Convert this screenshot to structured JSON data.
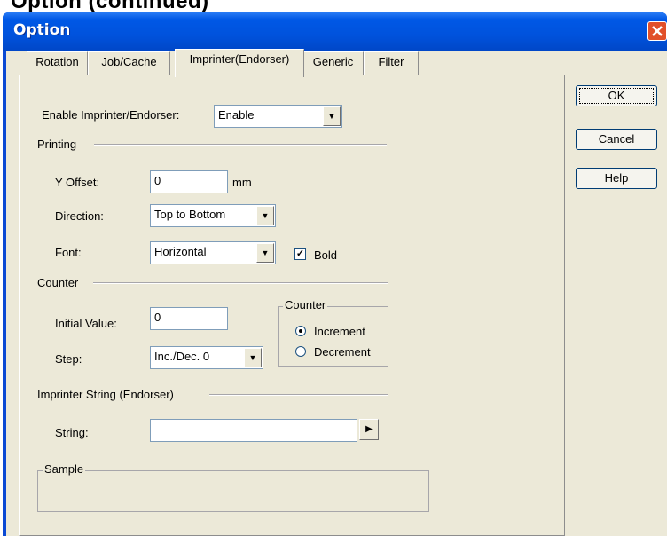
{
  "heading": "Option (continued)",
  "window": {
    "title": "Option"
  },
  "tabs": [
    {
      "label": "Rotation"
    },
    {
      "label": "Job/Cache"
    },
    {
      "label": "Imprinter(Endorser)"
    },
    {
      "label": "Generic"
    },
    {
      "label": "Filter"
    }
  ],
  "active_tab": "Imprinter(Endorser)",
  "buttons": {
    "ok": "OK",
    "cancel": "Cancel",
    "help": "Help"
  },
  "enable": {
    "label": "Enable Imprinter/Endorser:",
    "value": "Enable"
  },
  "printing": {
    "group": "Printing",
    "y_offset_label": "Y Offset:",
    "y_offset_value": "0",
    "y_offset_unit": "mm",
    "direction_label": "Direction:",
    "direction_value": "Top to Bottom",
    "font_label": "Font:",
    "font_value": "Horizontal",
    "bold_label": "Bold",
    "bold_checked": true
  },
  "counter": {
    "group": "Counter",
    "initial_label": "Initial Value:",
    "initial_value": "0",
    "step_label": "Step:",
    "step_value": "Inc./Dec. 0",
    "frame_label": "Counter",
    "increment_label": "Increment",
    "decrement_label": "Decrement",
    "selected": "Increment"
  },
  "imprinter_string": {
    "group": "Imprinter String (Endorser)",
    "string_label": "String:",
    "string_value": ""
  },
  "sample": {
    "label": "Sample"
  }
}
